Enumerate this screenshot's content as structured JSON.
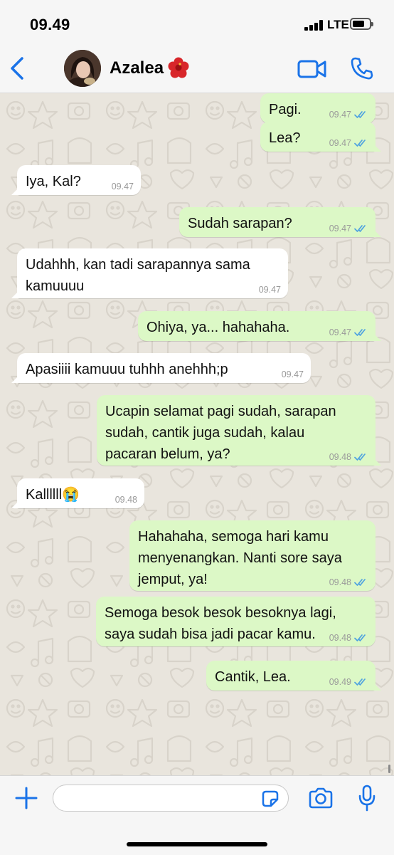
{
  "status": {
    "time": "09.49",
    "network": "LTE"
  },
  "header": {
    "name": "Azalea",
    "emoji": "🌺"
  },
  "colors": {
    "accent": "#1a73e8",
    "outgoing": "#dcf8c6",
    "incoming": "#ffffff",
    "tick": "#4fa3e0"
  },
  "icons": [
    "back-chevron-icon",
    "video-call-icon",
    "phone-icon",
    "plus-icon",
    "sticker-icon",
    "camera-icon",
    "microphone-icon"
  ],
  "messages": [
    {
      "dir": "out",
      "text": "Pagi.",
      "time": "09.47"
    },
    {
      "dir": "out",
      "text": "Lea?",
      "time": "09.47"
    },
    {
      "dir": "in",
      "text": "Iya, Kal?",
      "time": "09.47"
    },
    {
      "dir": "out",
      "text": "Sudah sarapan?",
      "time": "09.47"
    },
    {
      "dir": "in",
      "text": "Udahhh, kan tadi sarapannya sama\nkamuuuu",
      "time": "09.47"
    },
    {
      "dir": "out",
      "text": "Ohiya, ya... hahahaha.",
      "time": "09.47"
    },
    {
      "dir": "in",
      "text": "Apasiiii kamuuu tuhhh anehhh;p",
      "time": "09.47"
    },
    {
      "dir": "out",
      "text": "Ucapin selamat pagi sudah, sarapan\nsudah, cantik juga sudah, kalau\npacaran belum, ya?",
      "time": "09.48"
    },
    {
      "dir": "in",
      "text": "Kallllll😭",
      "time": "09.48"
    },
    {
      "dir": "out",
      "text": "Hahahaha, semoga hari kamu\nmenyenangkan. Nanti sore saya\njemput, ya!",
      "time": "09.48"
    },
    {
      "dir": "out",
      "text": "Semoga besok besok besoknya lagi,\nsaya sudah bisa jadi pacar kamu.",
      "time": "09.48"
    },
    {
      "dir": "out",
      "text": "Cantik, Lea.",
      "time": "09.49"
    }
  ],
  "input": {
    "value": "",
    "placeholder": ""
  }
}
